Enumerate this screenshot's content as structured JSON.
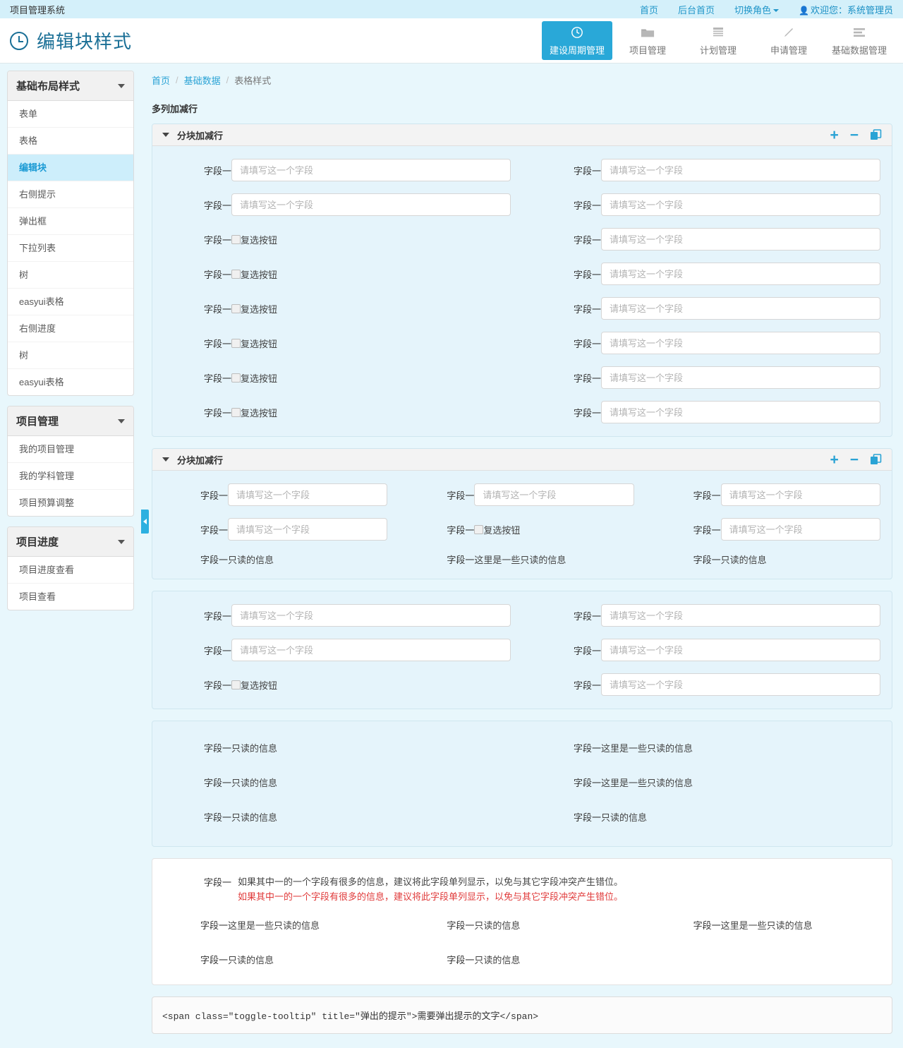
{
  "topbar": {
    "brand": "项目管理系统",
    "links": [
      {
        "label": "首页",
        "name": "home"
      },
      {
        "label": "后台首页",
        "name": "admin-home"
      },
      {
        "label": "切换角色",
        "name": "switch-role"
      }
    ],
    "user": "欢迎您：系统管理员"
  },
  "header": {
    "title": "编辑块样式",
    "tabs": [
      {
        "label": "建设周期管理",
        "icon": "clock-icon",
        "active": true
      },
      {
        "label": "项目管理",
        "icon": "folder-icon",
        "active": false
      },
      {
        "label": "计划管理",
        "icon": "calendar-icon",
        "active": false
      },
      {
        "label": "申请管理",
        "icon": "pencil-icon",
        "active": false
      },
      {
        "label": "基础数据管理",
        "icon": "list-icon",
        "active": false
      }
    ]
  },
  "sidebar": {
    "groups": [
      {
        "title": "基础布局样式",
        "items": [
          {
            "label": "表单",
            "active": false
          },
          {
            "label": "表格",
            "active": false
          },
          {
            "label": "编辑块",
            "active": true
          },
          {
            "label": "右侧提示",
            "active": false
          },
          {
            "label": "弹出框",
            "active": false
          },
          {
            "label": "下拉列表",
            "active": false
          },
          {
            "label": "树",
            "active": false
          },
          {
            "label": "easyui表格",
            "active": false
          },
          {
            "label": "右侧进度",
            "active": false
          },
          {
            "label": "树",
            "active": false
          },
          {
            "label": "easyui表格",
            "active": false
          }
        ]
      },
      {
        "title": "项目管理",
        "items": [
          {
            "label": "我的项目管理",
            "active": false
          },
          {
            "label": "我的学科管理",
            "active": false
          },
          {
            "label": "项目预算调整",
            "active": false
          }
        ]
      },
      {
        "title": "项目进度",
        "items": [
          {
            "label": "项目进度查看",
            "active": false
          },
          {
            "label": "项目查看",
            "active": false
          }
        ]
      }
    ]
  },
  "breadcrumb": {
    "items": [
      "首页",
      "基础数据",
      "表格样式"
    ],
    "separator": "/"
  },
  "main": {
    "section_title": "多列加减行",
    "field_label": "字段一",
    "placeholder": "请填写这一个字段",
    "checkbox_label": "复选按钮",
    "readonly_short": "只读的信息",
    "readonly_long": "这里是一些只读的信息",
    "block_title": "分块加减行",
    "actions": {
      "add": "+",
      "remove": "−",
      "copy": "copy-icon"
    },
    "long_text": "如果其中一的一个字段有很多的信息，建议将此字段单列显示，以免与其它字段冲突产生错位。",
    "long_text_warn": "如果其中一的一个字段有很多的信息，建议将此字段单列显示，以免与其它字段冲突产生错位。",
    "code_snippet": "<span class=\"toggle-tooltip\" title=\"弹出的提示\">需要弹出提示的文字</span>"
  },
  "colors": {
    "accent": "#29a8d8",
    "topbar_bg": "#d4f0fa",
    "page_bg": "#e8f7fc",
    "block_bg": "#e5f4fb",
    "warn": "#e03a3a"
  },
  "block1": {
    "left": [
      {
        "type": "input"
      },
      {
        "type": "input"
      },
      {
        "type": "checkbox"
      },
      {
        "type": "checkbox"
      },
      {
        "type": "checkbox"
      },
      {
        "type": "checkbox"
      },
      {
        "type": "checkbox"
      },
      {
        "type": "checkbox"
      }
    ],
    "right": [
      {
        "type": "input"
      },
      {
        "type": "input"
      },
      {
        "type": "input"
      },
      {
        "type": "input"
      },
      {
        "type": "input"
      },
      {
        "type": "input"
      },
      {
        "type": "input"
      },
      {
        "type": "input"
      }
    ]
  },
  "block2": {
    "rows": [
      [
        {
          "type": "input"
        },
        {
          "type": "input"
        },
        {
          "type": "input"
        }
      ],
      [
        {
          "type": "input"
        },
        {
          "type": "checkbox"
        },
        {
          "type": "input"
        }
      ],
      [
        {
          "type": "readonly",
          "value": "只读的信息"
        },
        {
          "type": "readonly",
          "value": "这里是一些只读的信息"
        },
        {
          "type": "readonly",
          "value": "只读的信息"
        }
      ]
    ]
  },
  "block3": {
    "rows": [
      [
        {
          "type": "input"
        },
        {
          "type": "input"
        }
      ],
      [
        {
          "type": "input"
        },
        {
          "type": "input"
        }
      ],
      [
        {
          "type": "checkbox"
        },
        {
          "type": "input"
        }
      ]
    ]
  },
  "block4": {
    "rows": [
      [
        {
          "type": "readonly",
          "value": "只读的信息"
        },
        {
          "type": "readonly",
          "value": "这里是一些只读的信息"
        }
      ],
      [
        {
          "type": "readonly",
          "value": "只读的信息"
        },
        {
          "type": "readonly",
          "value": "这里是一些只读的信息"
        }
      ],
      [
        {
          "type": "readonly",
          "value": "只读的信息"
        },
        {
          "type": "readonly",
          "value": "只读的信息"
        }
      ]
    ]
  },
  "block5": {
    "rows": [
      [
        {
          "type": "readonly",
          "value": "这里是一些只读的信息"
        },
        {
          "type": "readonly",
          "value": "只读的信息"
        },
        {
          "type": "readonly",
          "value": "这里是一些只读的信息"
        }
      ],
      [
        {
          "type": "readonly",
          "value": "只读的信息"
        },
        {
          "type": "readonly",
          "value": "只读的信息"
        },
        {
          "type": "empty"
        }
      ]
    ]
  }
}
